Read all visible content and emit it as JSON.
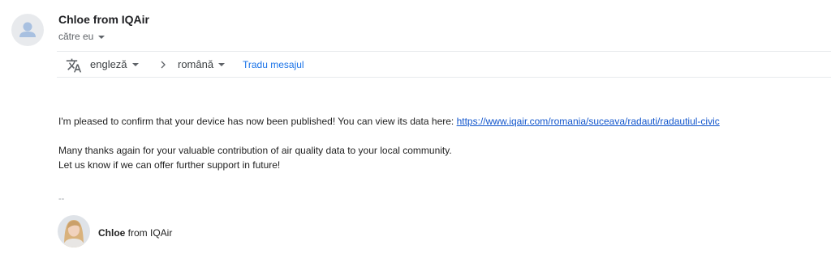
{
  "header": {
    "sender_name": "Chloe from IQAir",
    "recipient_label": "către eu"
  },
  "translate_bar": {
    "source_language": "engleză",
    "target_language": "română",
    "translate_link": "Tradu mesajul"
  },
  "message": {
    "paragraph1_text": "I'm pleased to confirm that your device has now been published! You can view its data here: ",
    "paragraph1_link": "https://www.iqair.com/romania/suceava/radauti/radautiul-civic",
    "paragraph2_line1": "Many thanks again for your valuable contribution of air quality data to your local community.",
    "paragraph2_line2": "Let us know if we can offer further support in future!"
  },
  "signature": {
    "separator": "--",
    "name_bold": "Chloe",
    "name_rest": " from IQAir"
  },
  "icons": {
    "sender_avatar": "person-avatar-icon",
    "translate": "translate-icon",
    "arrow": "chevron-right-icon",
    "dropdown": "caret-down-icon"
  },
  "colors": {
    "link": "#1155cc",
    "translate_link": "#1a73e8",
    "muted": "#5f6368"
  }
}
